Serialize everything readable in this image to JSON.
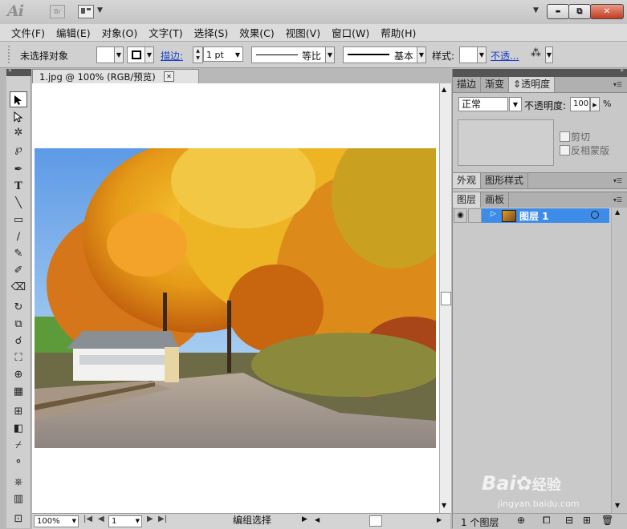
{
  "app": {
    "logo": "Ai",
    "bridge": "Br"
  },
  "window_controls": {
    "minimize": "▬",
    "restore": "⧉",
    "close": "✕"
  },
  "menu": [
    "文件(F)",
    "编辑(E)",
    "对象(O)",
    "文字(T)",
    "选择(S)",
    "效果(C)",
    "视图(V)",
    "窗口(W)",
    "帮助(H)"
  ],
  "control": {
    "selection_status": "未选择对象",
    "stroke_label": "描边:",
    "stroke_weight": "1 pt",
    "profile": "等比",
    "brush": "基本",
    "style_label": "样式:",
    "opacity_link": "不透..."
  },
  "document": {
    "tab_title": "1.jpg @ 100% (RGB/预览)"
  },
  "status": {
    "zoom": "100%",
    "artboard": "1",
    "tool": "编组选择"
  },
  "transparency": {
    "tabs": [
      "描边",
      "渐变",
      "⇕透明度"
    ],
    "mode": "正常",
    "opacity_label": "不透明度:",
    "opacity_value": "100",
    "percent": "%",
    "clip_label": "剪切",
    "invert_label": "反相蒙版"
  },
  "appearance": {
    "tabs": [
      "外观",
      "图形样式"
    ]
  },
  "layers": {
    "tabs": [
      "图层",
      "画板"
    ],
    "layer_name": "图层 1",
    "count": "1 个图层"
  },
  "watermark": {
    "brand": "Bai",
    "brand_suffix": "经验",
    "url": "jingyan.baidu.com"
  },
  "colors": {
    "selection": "#3d8ce8",
    "link": "#1a3fc8",
    "close": "#c33b20"
  }
}
